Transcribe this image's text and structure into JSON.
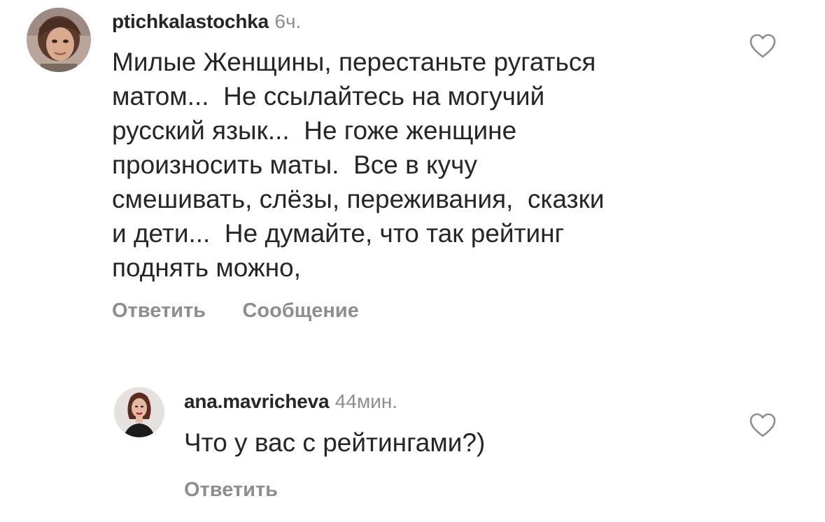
{
  "comments": [
    {
      "username": "ptichkalastochka",
      "time": "6ч.",
      "text": "Милые Женщины, перестаньте ругаться\nматом...  Не ссылайтесь на могучий\nрусский язык...  Не гоже женщине\nпроизносить маты.  Все в кучу\nсмешивать, слёзы, переживания,  сказки\nи дети...  Не думайте, что так рейтинг\nподнять можно,",
      "reply_label": "Ответить",
      "message_label": "Сообщение",
      "like_icon": "heart-outline-icon"
    },
    {
      "username": "ana.mavricheva",
      "time": "44мин.",
      "text": "Что у вас с рейтингами?)",
      "reply_label": "Ответить",
      "like_icon": "heart-outline-icon"
    }
  ],
  "colors": {
    "text": "#262626",
    "secondary": "#8e8e8e",
    "background": "#ffffff"
  }
}
